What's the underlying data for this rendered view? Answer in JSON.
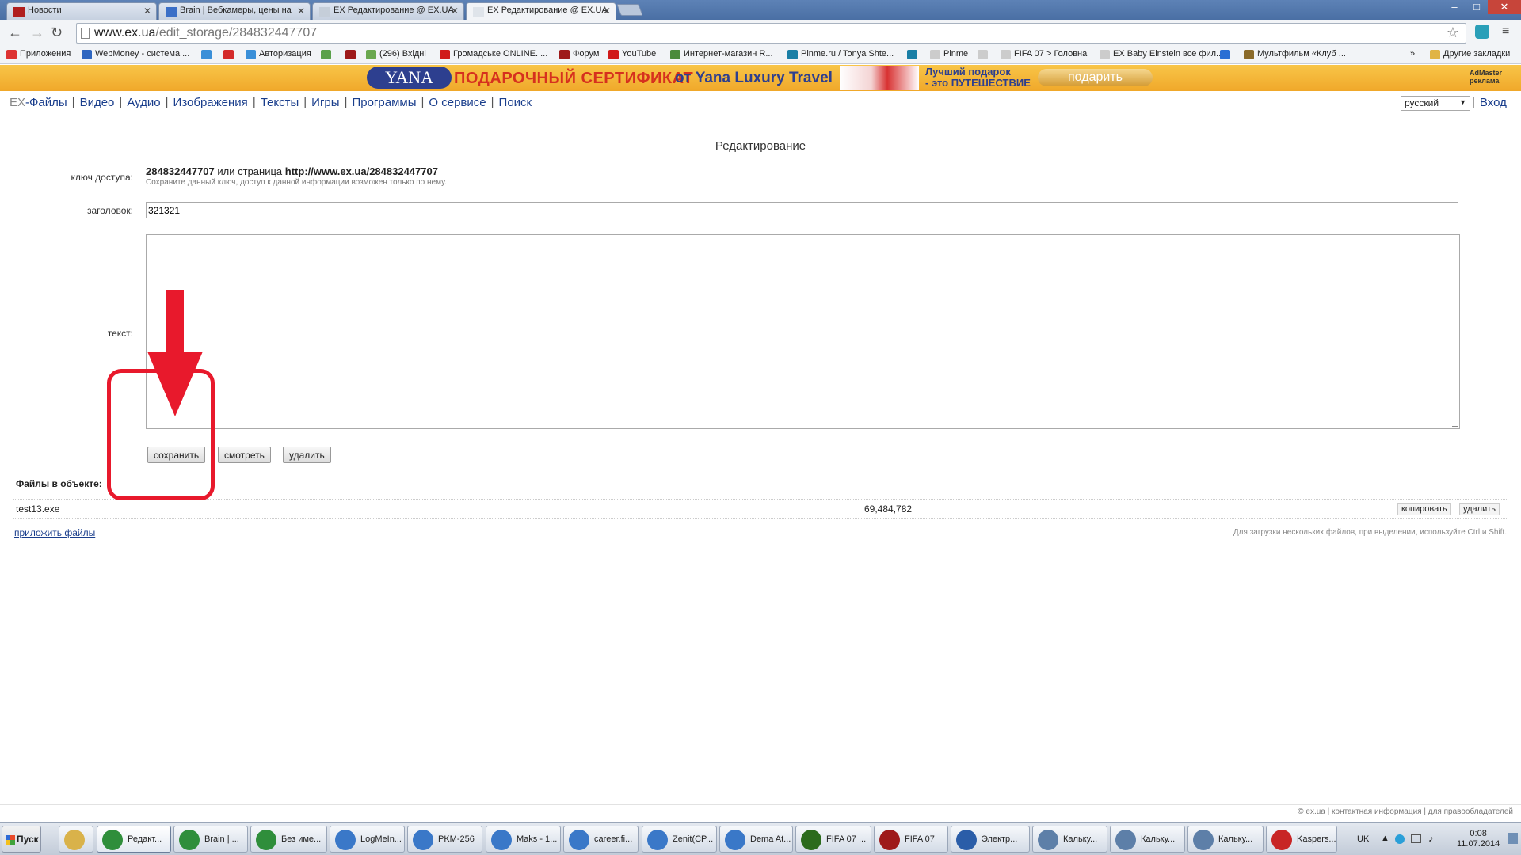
{
  "tabs": [
    {
      "label": "Новости",
      "favicon_color": "#b01e1e"
    },
    {
      "label": "Brain | Вебкамеры, цены на",
      "favicon_color": "#3b6fc7"
    },
    {
      "label": "EX Редактирование @ EX.UA",
      "favicon_color": "#7a8aa0"
    },
    {
      "label": "EX Редактирование @ EX.UA",
      "favicon_color": "#7a8aa0"
    }
  ],
  "window_controls": {
    "minimize": "–",
    "maximize": "□",
    "close": "✕"
  },
  "toolbar": {
    "url_host": "www.ex.ua",
    "url_path": "/edit_storage/284832447707"
  },
  "bookmarks": [
    {
      "label": "Приложения",
      "color": "#d33"
    },
    {
      "label": "WebMoney - система ...",
      "color": "#2f66c0"
    },
    {
      "label": "",
      "color": "#3a8fd8"
    },
    {
      "label": "",
      "color": "#d42b2b"
    },
    {
      "label": "Авторизация",
      "color": "#3a8fd8"
    },
    {
      "label": "",
      "color": "#5aa04a"
    },
    {
      "label": "",
      "color": "#9e1a1a"
    },
    {
      "label": "(296) Вхідні",
      "color": "#6aa84f"
    },
    {
      "label": "Громадське ONLINE. ...",
      "color": "#d01a1a"
    },
    {
      "label": "Форум",
      "color": "#9e1a1a"
    },
    {
      "label": "YouTube",
      "color": "#d01a1a"
    },
    {
      "label": "Интернет-магазин R...",
      "color": "#4b8b3b"
    },
    {
      "label": "Pinme.ru / Tonya Shte...",
      "color": "#1a7fa6"
    },
    {
      "label": "",
      "color": "#1a7fa6"
    },
    {
      "label": "Pinme",
      "color": "#cccccc"
    },
    {
      "label": "",
      "color": "#cccccc"
    },
    {
      "label": "FIFA 07 > Головна",
      "color": "#cccccc"
    },
    {
      "label": "EX Baby Einstein все фил...",
      "color": "#cccccc"
    },
    {
      "label": "",
      "color": "#2a6fd4"
    },
    {
      "label": "Мультфильм «Клуб ...",
      "color": "#8a6a2a"
    },
    {
      "label": "»",
      "color": ""
    },
    {
      "label": "Другие закладки",
      "color": "#e0b445"
    }
  ],
  "banner": {
    "logo": "YANA",
    "headline": "ПОДАРОЧНЫЙ СЕРТИФИКАТ",
    "headline2": "от Yana Luxury Travel",
    "sub_line1": "Лучший подарок",
    "sub_line2": "- это ПУТЕШЕСТВИЕ",
    "button": "подарить",
    "admaster_line1": "AdMaster",
    "admaster_line2": "реклама"
  },
  "sitenav": {
    "logo": "EX",
    "items": [
      "-Файлы",
      "Видео",
      "Аудио",
      "Изображения",
      "Тексты",
      "Игры",
      "Программы",
      "О сервисе",
      "Поиск"
    ],
    "language": "русский",
    "login": "Вход"
  },
  "form": {
    "title": "Редактирование",
    "key_label": "ключ доступа:",
    "key_value": "284832447707",
    "key_or": "или страница",
    "key_url": "http://www.ex.ua/284832447707",
    "key_note": "Сохраните данный ключ, доступ к данной информации возможен только по нему.",
    "title_label": "заголовок:",
    "title_value": "321321",
    "text_label": "текст:",
    "text_value": "",
    "buttons": {
      "save": "сохранить",
      "view": "смотреть",
      "delete": "удалить"
    }
  },
  "files": {
    "heading": "Файлы в объекте:",
    "rows": [
      {
        "name": "test13.exe",
        "size": "69,484,782",
        "copy": "копировать",
        "delete": "удалить"
      }
    ],
    "attach": "приложить файлы",
    "hint": "Для загрузки нескольких файлов, при выделении, используйте Ctrl и Shift."
  },
  "footer": "© ex.ua | контактная информация | для правообладателей",
  "annotation_color": "#e8192c",
  "taskbar": {
    "start": "Пуск",
    "items": [
      {
        "label": "",
        "color": "#d9b24a"
      },
      {
        "label": "Редакт...",
        "color": "#2f8e3b"
      },
      {
        "label": "Brain | ...",
        "color": "#2f8e3b"
      },
      {
        "label": "Без име...",
        "color": "#2f8e3b"
      },
      {
        "label": "LogMeIn...",
        "color": "#3a78c8"
      },
      {
        "label": "PKM-256",
        "color": "#3a78c8"
      },
      {
        "label": "Maks - 1...",
        "color": "#3a78c8"
      },
      {
        "label": "career.fi...",
        "color": "#3a78c8"
      },
      {
        "label": "Zenit(CP...",
        "color": "#3a78c8"
      },
      {
        "label": "Dema At...",
        "color": "#3a78c8"
      },
      {
        "label": "FIFA 07 ...",
        "color": "#2c6b1d"
      },
      {
        "label": "FIFA 07",
        "color": "#9e1a1a"
      },
      {
        "label": "Электр...",
        "color": "#2a5da8"
      },
      {
        "label": "Кальку...",
        "color": "#5d7fa8"
      },
      {
        "label": "Кальку...",
        "color": "#5d7fa8"
      },
      {
        "label": "Кальку...",
        "color": "#5d7fa8"
      },
      {
        "label": "Kaspers...",
        "color": "#c82525"
      }
    ],
    "tray_lang": "UK",
    "time": "0:08",
    "date": "11.07.2014"
  }
}
